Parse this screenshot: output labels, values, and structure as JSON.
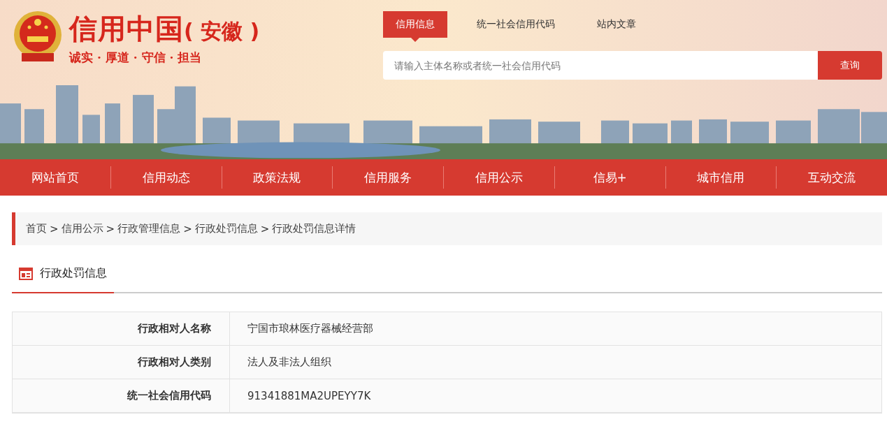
{
  "header": {
    "site_title": "信用中国",
    "site_region": "( 安徽 )",
    "slogan": "诚实 · 厚道 · 守信 · 担当"
  },
  "search": {
    "tabs": [
      {
        "label": "信用信息",
        "selected": true
      },
      {
        "label": "统一社会信用代码",
        "selected": false
      },
      {
        "label": "站内文章",
        "selected": false
      }
    ],
    "placeholder": "请输入主体名称或者统一社会信用代码",
    "button": "查询"
  },
  "nav": [
    "网站首页",
    "信用动态",
    "政策法规",
    "信用服务",
    "信用公示",
    "信易+",
    "城市信用",
    "互动交流"
  ],
  "breadcrumb": {
    "separator": ">",
    "items": [
      "首页",
      "信用公示",
      "行政管理信息",
      "行政处罚信息",
      "行政处罚信息详情"
    ]
  },
  "section": {
    "title": "行政处罚信息"
  },
  "table": {
    "rows": [
      {
        "label": "行政相对人名称",
        "value": "宁国市琅林医疗器械经营部"
      },
      {
        "label": "行政相对人类别",
        "value": "法人及非法人组织"
      },
      {
        "label": "统一社会信用代码",
        "value": "91341881MA2UPEYY7K"
      }
    ]
  }
}
